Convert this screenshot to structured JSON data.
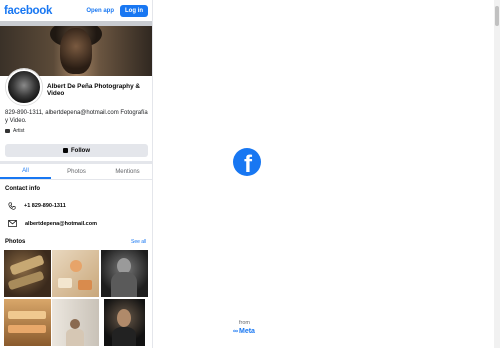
{
  "header": {
    "logo": "facebook",
    "open_app": "Open app",
    "login": "Log in"
  },
  "profile": {
    "name": "Albert De Peña Photography & Video",
    "description": "829-890-1311, albertdepena@hotmail.com Fotografía y Video.",
    "category": "Artist",
    "follow_label": "Follow"
  },
  "tabs": [
    "All",
    "Photos",
    "Mentions"
  ],
  "contact": {
    "title": "Contact info",
    "phone": "+1 829-890-1311",
    "email": "albertdepena@hotmail.com"
  },
  "photos": {
    "title": "Photos",
    "see_all": "See all"
  },
  "splash": {
    "from": "from",
    "meta": "Meta"
  },
  "colors": {
    "brand": "#1877f2",
    "button_bg": "#e4e6eb"
  }
}
